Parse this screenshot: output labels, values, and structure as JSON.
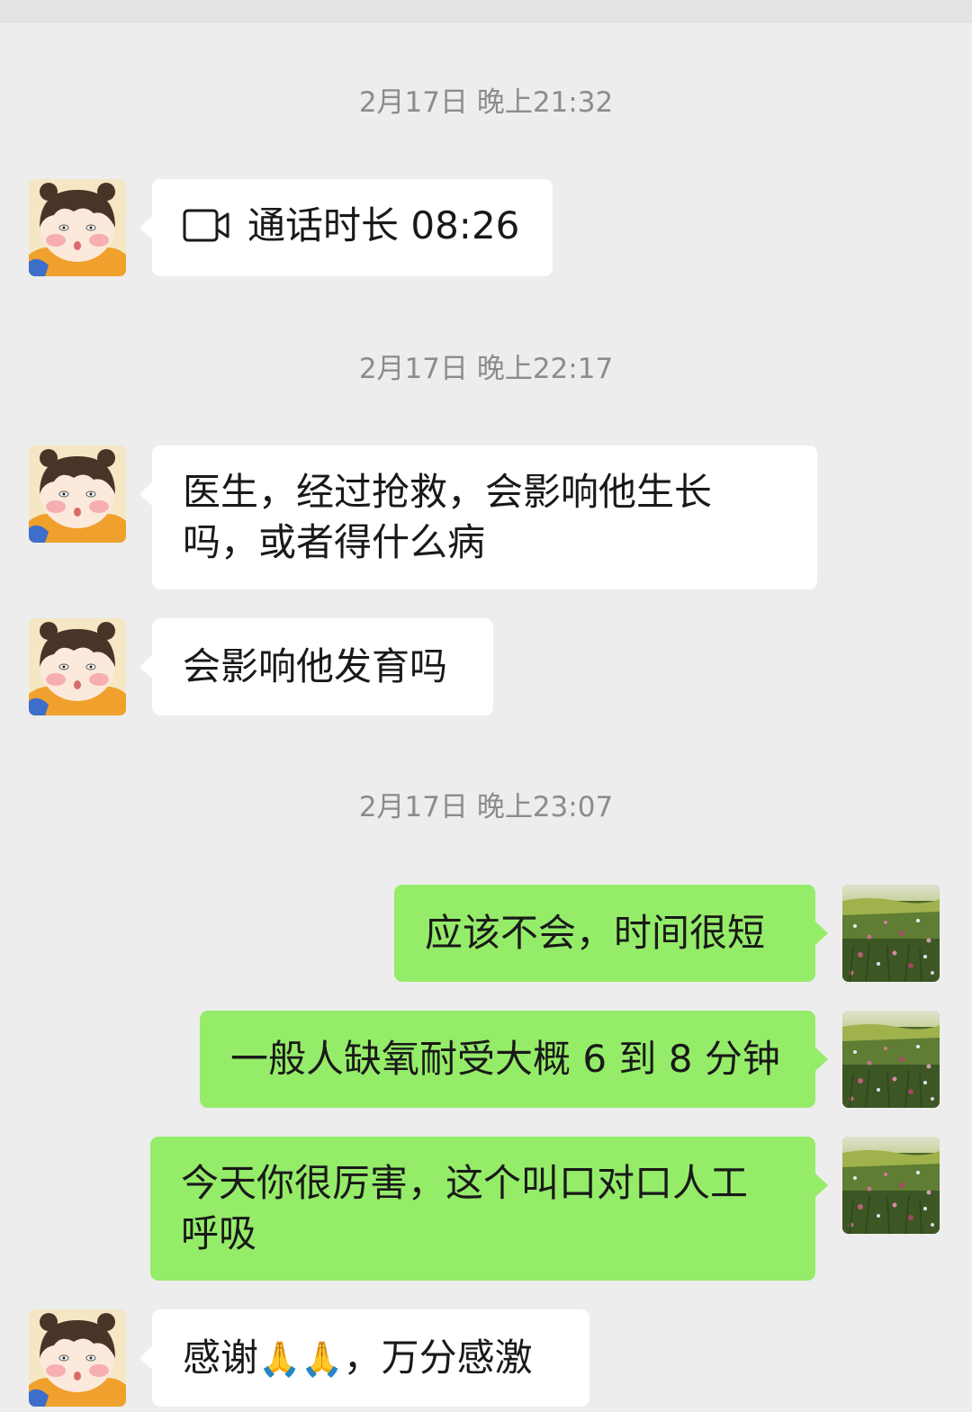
{
  "messages": {
    "ts1": "2月17日 晚上21:32",
    "call_label": "通话时长 08:26",
    "ts2": "2月17日 晚上22:17",
    "msg1": "医生，经过抢救，会影响他生长吗，或者得什么病",
    "msg2": "会影响他发育吗",
    "ts3": "2月17日 晚上23:07",
    "reply1": "应该不会，时间很短",
    "reply2": "一般人缺氧耐受大概 6 到 8 分钟",
    "reply3": "今天你很厉害，这个叫口对口人工呼吸",
    "msg3_a": "感谢",
    "msg3_emoji": "🙏🙏",
    "msg3_b": "，万分感激"
  },
  "icons": {
    "call": "video-camera-icon",
    "contact_avatar": "cartoon-girl-avatar",
    "self_avatar": "flower-meadow-avatar"
  },
  "colors": {
    "background": "#ededed",
    "incoming_bubble": "#ffffff",
    "outgoing_bubble": "#95ec69",
    "timestamp": "#8c8c8c"
  }
}
